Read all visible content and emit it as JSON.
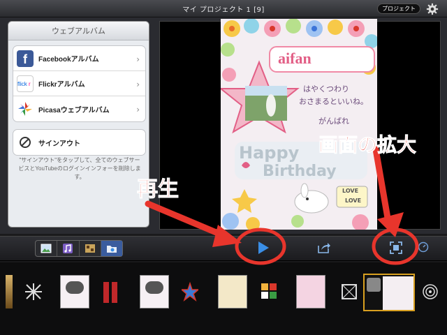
{
  "topbar": {
    "title": "マイ プロジェクト 1  [9]",
    "project_button": "プロジェクト"
  },
  "panel": {
    "title": "ウェブアルバム",
    "services": [
      {
        "label": "Facebookアルバム",
        "icon": "facebook-icon"
      },
      {
        "label": "Flickrアルバム",
        "icon": "flickr-icon"
      },
      {
        "label": "Picasaウェブアルバム",
        "icon": "picasa-icon"
      }
    ],
    "signout_label": "サインアウト",
    "description": "\"サインアウト\"をタップして、全てのウェブサービスとYouTubeのログインインフォーを削除します。"
  },
  "preview": {
    "card_title": "aifan",
    "card_message_1": "はやくつわり",
    "card_message_2": "おさまるといいね。",
    "card_message_3": "がんばれ",
    "card_happy": "Happy",
    "card_birthday": "Birthday",
    "card_love_1": "LOVE",
    "card_love_2": "LOVE"
  },
  "annotations": {
    "play_label": "再生",
    "zoom_label": "画面の拡大"
  },
  "controls": {
    "media_tabs": [
      "photos-icon",
      "music-icon",
      "video-icon",
      "folder-icon"
    ]
  },
  "colors": {
    "annotation": "#e8352c",
    "accent": "#3a8ee6",
    "facebook": "#3b5998"
  }
}
